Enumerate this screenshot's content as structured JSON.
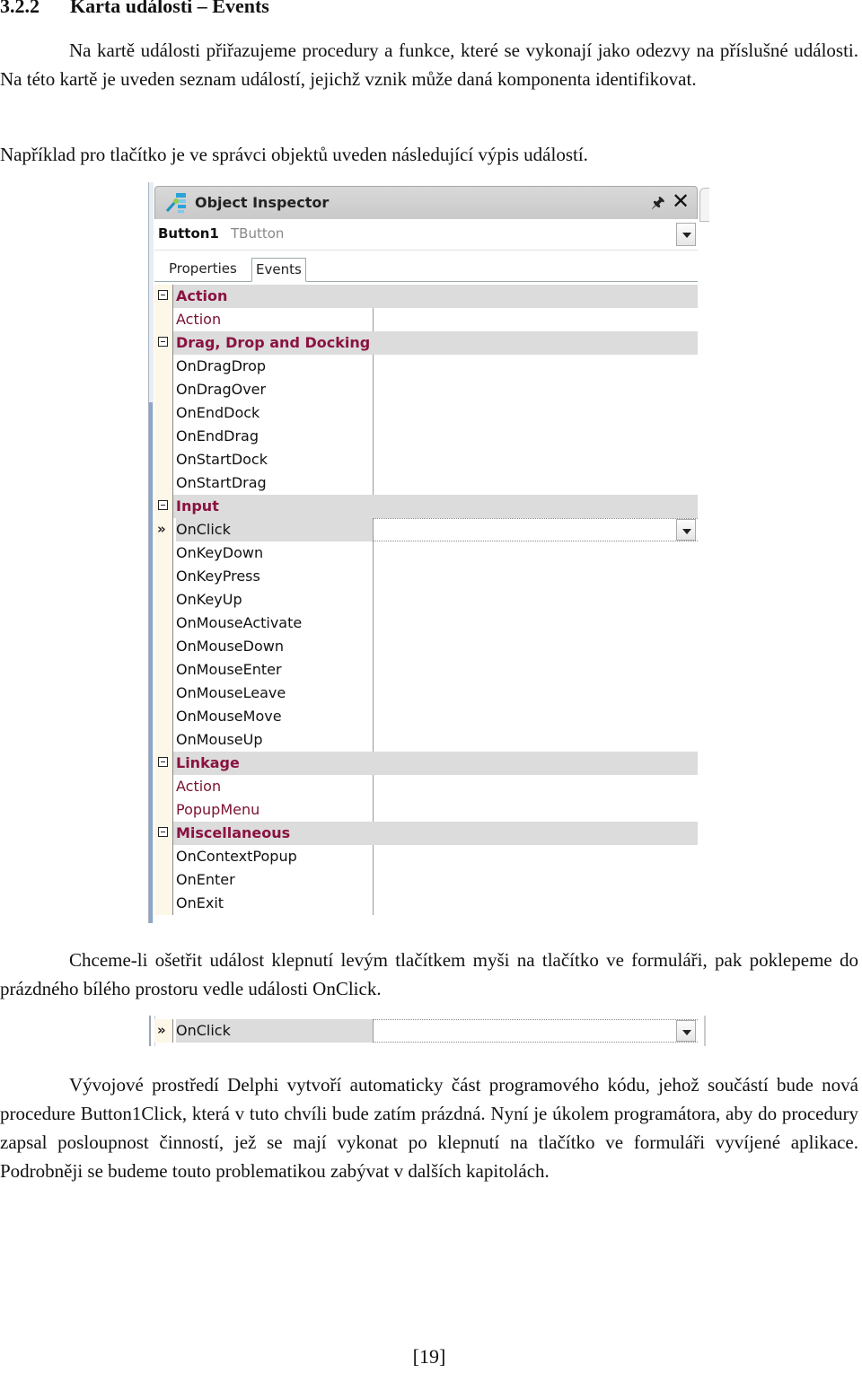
{
  "heading": {
    "number": "3.2.2",
    "title": "Karta události – Events"
  },
  "paragraphs": [
    "Na kartě události přiřazujeme procedury a funkce, které se vykonají jako odezvy na příslušné události. Na této kartě je uveden seznam událostí, jejichž vznik může daná komponenta identifikovat.",
    "Například pro tlačítko je ve správci objektů uveden následující výpis událostí.",
    "Chceme-li ošetřit událost klepnutí levým tlačítkem myši na tlačítko ve formuláři, pak poklepeme do prázdného bílého prostoru vedle události OnClick.",
    "Vývojové prostředí Delphi vytvoří automaticky část programového kódu, jehož součástí bude nová procedure Button1Click, která v tuto chvíli bude zatím prázdná. Nyní je úkolem programátora, aby do procedury zapsal posloupnost činností, jež se mají vykonat po klepnutí na tlačítko ve formuláři vyvíjené aplikace. Podrobněji se budeme touto problematikou zabývat v dalších kapitolách."
  ],
  "inspector": {
    "title": "Object Inspector",
    "icons": {
      "app": "object-inspector-icon",
      "pin": "pin-icon",
      "close": "close-icon"
    },
    "selected_object": {
      "name": "Button1",
      "class": "TButton"
    },
    "tabs": [
      {
        "label": "Properties",
        "active": false
      },
      {
        "label": "Events",
        "active": true
      }
    ],
    "categories": [
      {
        "label": "Action",
        "items": [
          {
            "label": "Action",
            "ref": true
          }
        ]
      },
      {
        "label": "Drag, Drop and Docking",
        "items": [
          {
            "label": "OnDragDrop"
          },
          {
            "label": "OnDragOver"
          },
          {
            "label": "OnEndDock"
          },
          {
            "label": "OnEndDrag"
          },
          {
            "label": "OnStartDock"
          },
          {
            "label": "OnStartDrag"
          }
        ]
      },
      {
        "label": "Input",
        "items": [
          {
            "label": "OnClick",
            "selected": true
          },
          {
            "label": "OnKeyDown"
          },
          {
            "label": "OnKeyPress"
          },
          {
            "label": "OnKeyUp"
          },
          {
            "label": "OnMouseActivate"
          },
          {
            "label": "OnMouseDown"
          },
          {
            "label": "OnMouseEnter"
          },
          {
            "label": "OnMouseLeave"
          },
          {
            "label": "OnMouseMove"
          },
          {
            "label": "OnMouseUp"
          }
        ]
      },
      {
        "label": "Linkage",
        "items": [
          {
            "label": "Action",
            "ref": true
          },
          {
            "label": "PopupMenu",
            "ref": true
          }
        ]
      },
      {
        "label": "Miscellaneous",
        "items": [
          {
            "label": "OnContextPopup"
          },
          {
            "label": "OnEnter"
          },
          {
            "label": "OnExit"
          }
        ]
      }
    ],
    "colors": {
      "category_text": "#8a1240",
      "category_bg": "#dcdcdc",
      "gutter_bg": "#fdf7e8"
    }
  },
  "snippet": {
    "label": "OnClick",
    "value": ""
  },
  "page_number": "[19]"
}
